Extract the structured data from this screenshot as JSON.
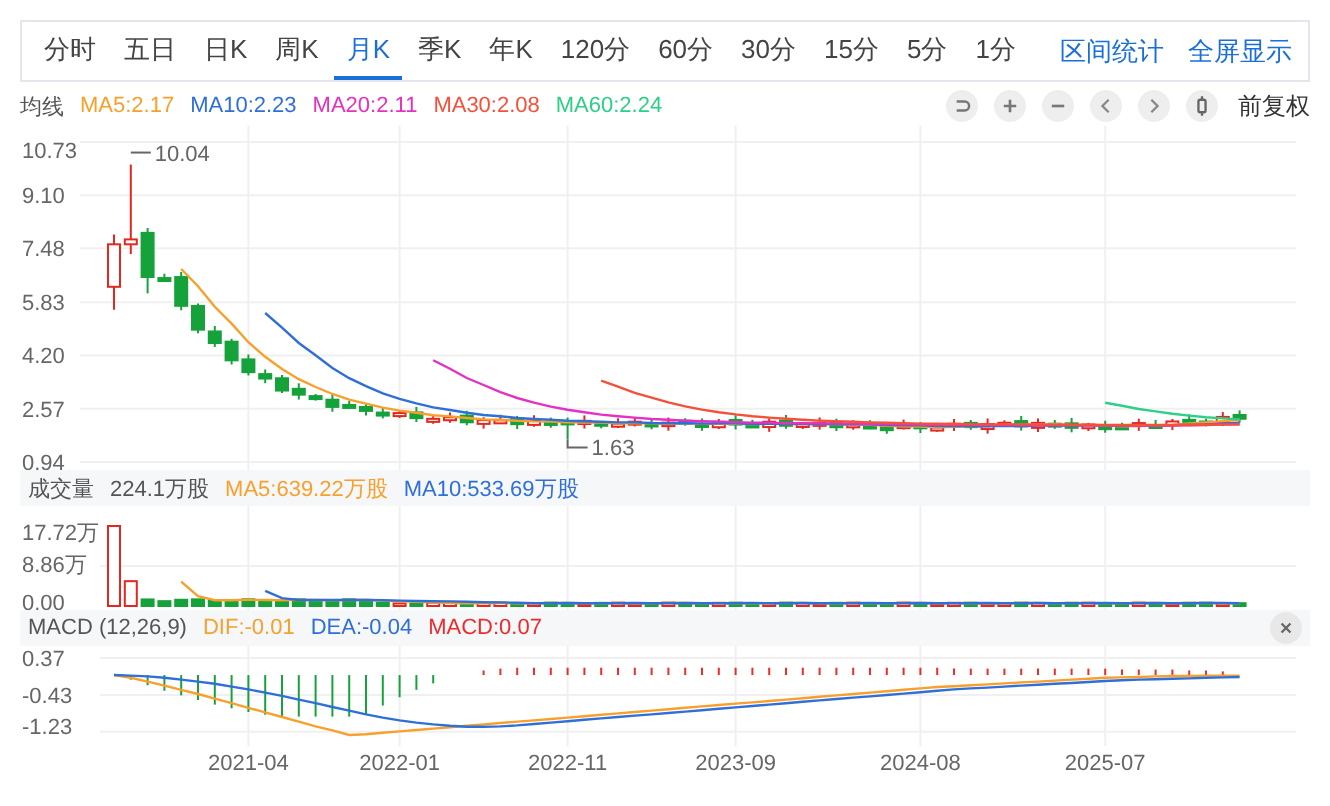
{
  "tabs": [
    {
      "label": "分时",
      "selected": false
    },
    {
      "label": "五日",
      "selected": false
    },
    {
      "label": "日K",
      "selected": false
    },
    {
      "label": "周K",
      "selected": false
    },
    {
      "label": "月K",
      "selected": true
    },
    {
      "label": "季K",
      "selected": false
    },
    {
      "label": "年K",
      "selected": false
    },
    {
      "label": "120分",
      "selected": false
    },
    {
      "label": "60分",
      "selected": false
    },
    {
      "label": "30分",
      "selected": false
    },
    {
      "label": "15分",
      "selected": false
    },
    {
      "label": "5分",
      "selected": false
    },
    {
      "label": "1分",
      "selected": false
    }
  ],
  "links": [
    "区间统计",
    "全屏显示"
  ],
  "ma_legend": {
    "label": "均线",
    "items": [
      {
        "text": "MA5:2.17",
        "color": "#f7a02c"
      },
      {
        "text": "MA10:2.23",
        "color": "#2f6fd8"
      },
      {
        "text": "MA20:2.11",
        "color": "#e530c4"
      },
      {
        "text": "MA30:2.08",
        "color": "#f4503a"
      },
      {
        "text": "MA60:2.24",
        "color": "#2ecf87"
      }
    ]
  },
  "adjust": "前复权",
  "price_chart": {
    "y_labels": [
      "10.73",
      "9.10",
      "7.48",
      "5.83",
      "4.20",
      "2.57",
      "0.94"
    ],
    "annotations": [
      "10.04",
      "1.63"
    ]
  },
  "volume": {
    "label": "成交量",
    "value": "224.1万股",
    "items": [
      {
        "text": "MA5:639.22万股",
        "color": "#f7a02c"
      },
      {
        "text": "MA10:533.69万股",
        "color": "#2f6fd8"
      }
    ],
    "y_labels": [
      "17.72万",
      "8.86万",
      "0.00"
    ]
  },
  "macd": {
    "label": "MACD (12,26,9)",
    "items": [
      {
        "text": "DIF:-0.01",
        "color": "#f7a02c"
      },
      {
        "text": "DEA:-0.04",
        "color": "#2f6fd8"
      },
      {
        "text": "MACD:0.07",
        "color": "#ee2b2b"
      }
    ],
    "chart_data": {
      "type": "line",
      "ylim": [
        -1.32,
        0.37
      ],
      "yticks": [
        0.37,
        -0.43,
        -1.23
      ],
      "grid": true,
      "series": [
        {
          "color": "#f7a02c",
          "values": [
            0,
            -0.06,
            -0.14,
            -0.23,
            -0.32,
            -0.41,
            -0.51,
            -0.61,
            -0.71,
            -0.81,
            -0.91,
            -1.01,
            -1.11,
            -1.2,
            -1.3,
            -1.28,
            -1.25,
            -1.22,
            -1.19,
            -1.16,
            -1.13,
            -1.1,
            -1.07,
            -1.04,
            -1.01,
            -0.98,
            -0.95,
            -0.92,
            -0.89,
            -0.86,
            -0.83,
            -0.8,
            -0.77,
            -0.74,
            -0.71,
            -0.68,
            -0.65,
            -0.62,
            -0.59,
            -0.56,
            -0.53,
            -0.5,
            -0.47,
            -0.44,
            -0.41,
            -0.38,
            -0.35,
            -0.32,
            -0.29,
            -0.26,
            -0.24,
            -0.22,
            -0.2,
            -0.18,
            -0.16,
            -0.14,
            -0.12,
            -0.1,
            -0.08,
            -0.06,
            -0.05,
            -0.04,
            -0.03,
            -0.02,
            -0.02,
            -0.01,
            -0.01,
            -0.01
          ]
        },
        {
          "color": "#2f6fd8",
          "values": [
            0,
            -0.01,
            -0.03,
            -0.06,
            -0.1,
            -0.14,
            -0.19,
            -0.25,
            -0.31,
            -0.38,
            -0.45,
            -0.53,
            -0.61,
            -0.69,
            -0.77,
            -0.85,
            -0.92,
            -0.98,
            -1.03,
            -1.07,
            -1.1,
            -1.12,
            -1.12,
            -1.11,
            -1.09,
            -1.06,
            -1.03,
            -1.0,
            -0.97,
            -0.94,
            -0.91,
            -0.88,
            -0.85,
            -0.82,
            -0.79,
            -0.76,
            -0.73,
            -0.7,
            -0.67,
            -0.64,
            -0.61,
            -0.58,
            -0.55,
            -0.52,
            -0.49,
            -0.46,
            -0.43,
            -0.4,
            -0.37,
            -0.34,
            -0.31,
            -0.29,
            -0.27,
            -0.25,
            -0.23,
            -0.21,
            -0.19,
            -0.17,
            -0.15,
            -0.13,
            -0.11,
            -0.1,
            -0.09,
            -0.08,
            -0.07,
            -0.06,
            -0.05,
            -0.04
          ]
        }
      ]
    }
  },
  "x_labels": [
    "2021-04",
    "2022-01",
    "2022-11",
    "2023-09",
    "2024-08",
    "2025-07"
  ]
}
